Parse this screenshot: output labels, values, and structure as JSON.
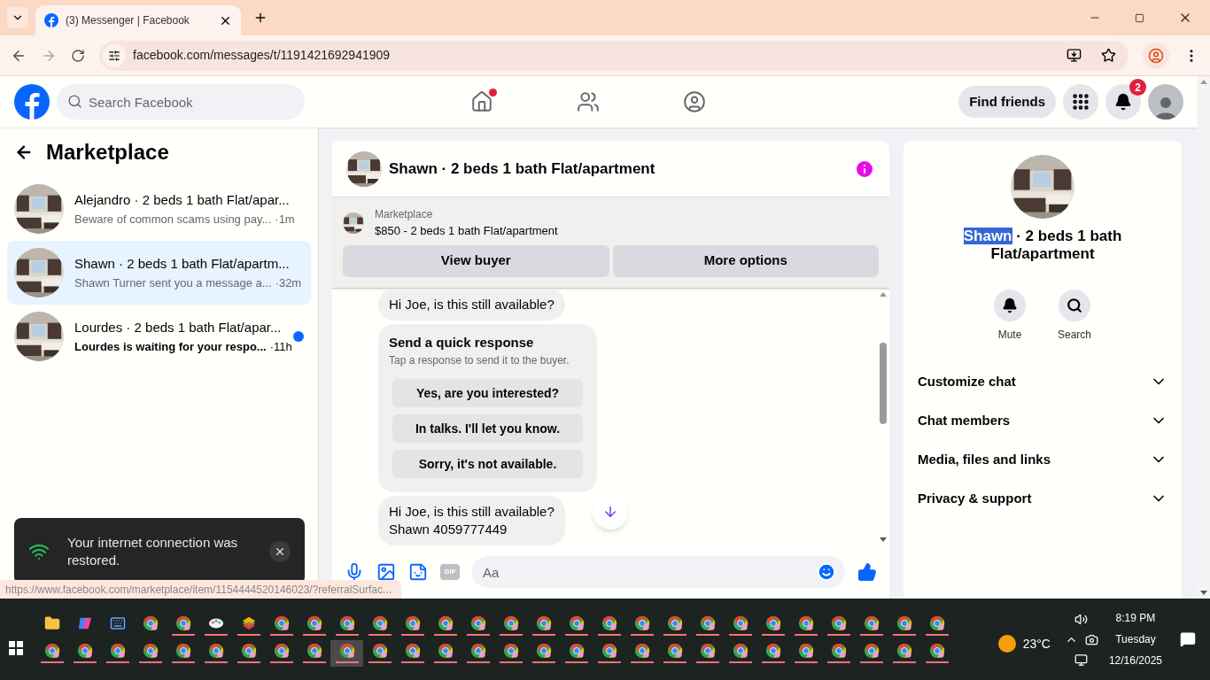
{
  "browser": {
    "tab_title": "(3) Messenger | Facebook",
    "url": "facebook.com/messages/t/1191421692941909",
    "status_url": "https://www.facebook.com/marketplace/item/1154444520146023/?referralSurfac..."
  },
  "header": {
    "search_placeholder": "Search Facebook",
    "nav": [
      {
        "kind": "home",
        "selected": false,
        "dot": true
      },
      {
        "kind": "friends",
        "selected": false,
        "dot": false
      },
      {
        "kind": "groups",
        "selected": false,
        "dot": false
      }
    ],
    "find_friends": "Find friends",
    "notifications_badge": "2"
  },
  "sidebar": {
    "title": "Marketplace",
    "chats": [
      {
        "name": "Alejandro · 2 beds 1 bath Flat/apar...",
        "preview": "Beware of common scams using pay...",
        "time": "·1m",
        "selected": false,
        "unread": false
      },
      {
        "name": "Shawn · 2 beds 1 bath Flat/apartm...",
        "preview": "Shawn Turner sent you a message a...",
        "time": "·32m",
        "selected": true,
        "unread": false
      },
      {
        "name": "Lourdes · 2 beds 1 bath Flat/apar...",
        "preview": "Lourdes is waiting for your respo...",
        "time": "·11h",
        "selected": false,
        "unread": true
      }
    ]
  },
  "chat": {
    "title": "Shawn · 2 beds 1 bath Flat/apartment",
    "listing": {
      "label": "Marketplace",
      "title": "$850 - 2 beds 1 bath Flat/apartment"
    },
    "actions": [
      "View buyer",
      "More options"
    ],
    "messages": [
      {
        "kind": "text",
        "lines": [
          "Hi Joe, is this still available?"
        ]
      },
      {
        "kind": "quick_response",
        "title": "Send a quick response",
        "subtitle": "Tap a response to send it to the buyer.",
        "options": [
          "Yes, are you interested?",
          "In talks. I'll let you know.",
          "Sorry, it's not available."
        ]
      },
      {
        "kind": "text",
        "lines": [
          "Hi Joe, is this still available?",
          "Shawn 4059777449"
        ]
      }
    ],
    "composer_placeholder": "Aa",
    "gif_label": "GIF"
  },
  "info": {
    "highlighted": "Shawn",
    "title_rest": " · 2 beds 1 bath Flat/apartment",
    "actions": [
      {
        "kind": "mute",
        "label": "Mute"
      },
      {
        "kind": "search",
        "label": "Search"
      }
    ],
    "sections": [
      {
        "label": "Customize chat",
        "expanded": false
      },
      {
        "label": "Chat members",
        "expanded": false
      },
      {
        "label": "Media, files and links",
        "expanded": false
      },
      {
        "label": "Privacy & support",
        "expanded": false
      }
    ]
  },
  "toast": {
    "text": "Your internet connection was restored."
  },
  "taskbar": {
    "top_row": [
      {
        "kind": "folder",
        "open": false,
        "selected": false
      },
      {
        "kind": "copilot",
        "open": false,
        "selected": false
      },
      {
        "kind": "keyboard",
        "open": false,
        "selected": false
      },
      {
        "kind": "chrome",
        "open": false,
        "selected": false
      },
      {
        "kind": "chrome",
        "open": true,
        "selected": false
      },
      {
        "kind": "paint",
        "open": true,
        "selected": false
      },
      {
        "kind": "stack",
        "open": true,
        "selected": false
      },
      {
        "kind": "chrome",
        "open": true,
        "selected": false
      },
      {
        "kind": "chrome",
        "open": true,
        "selected": false
      },
      {
        "kind": "chrome",
        "open": true,
        "selected": false
      },
      {
        "kind": "chrome",
        "open": true,
        "selected": false
      },
      {
        "kind": "chrome",
        "open": true,
        "selected": false
      },
      {
        "kind": "chrome",
        "open": true,
        "selected": false
      },
      {
        "kind": "chrome",
        "open": true,
        "selected": false
      },
      {
        "kind": "chrome",
        "open": true,
        "selected": false
      },
      {
        "kind": "chrome",
        "open": true,
        "selected": false
      },
      {
        "kind": "chrome",
        "open": true,
        "selected": false
      },
      {
        "kind": "chrome",
        "open": true,
        "selected": false
      },
      {
        "kind": "chrome",
        "open": true,
        "selected": false
      },
      {
        "kind": "chrome",
        "open": true,
        "selected": false
      },
      {
        "kind": "chrome",
        "open": true,
        "selected": false
      },
      {
        "kind": "chrome",
        "open": true,
        "selected": false
      },
      {
        "kind": "chrome",
        "open": true,
        "selected": false
      },
      {
        "kind": "chrome",
        "open": true,
        "selected": false
      },
      {
        "kind": "chrome",
        "open": true,
        "selected": false
      },
      {
        "kind": "chrome",
        "open": true,
        "selected": false
      },
      {
        "kind": "chrome",
        "open": true,
        "selected": false
      },
      {
        "kind": "chrome",
        "open": true,
        "selected": false
      }
    ],
    "bottom_row": [
      {
        "kind": "chrome",
        "open": true,
        "selected": false
      },
      {
        "kind": "chrome",
        "open": true,
        "selected": false
      },
      {
        "kind": "chrome",
        "open": true,
        "selected": false
      },
      {
        "kind": "chrome",
        "open": true,
        "selected": false
      },
      {
        "kind": "chrome",
        "open": true,
        "selected": false
      },
      {
        "kind": "chrome",
        "open": true,
        "selected": false
      },
      {
        "kind": "chrome",
        "open": true,
        "selected": false
      },
      {
        "kind": "chrome",
        "open": true,
        "selected": false
      },
      {
        "kind": "chrome",
        "open": true,
        "selected": false
      },
      {
        "kind": "chrome",
        "open": true,
        "selected": true
      },
      {
        "kind": "chrome",
        "open": true,
        "selected": false
      },
      {
        "kind": "chrome",
        "open": true,
        "selected": false
      },
      {
        "kind": "chrome",
        "open": true,
        "selected": false
      },
      {
        "kind": "chrome",
        "open": true,
        "selected": false
      },
      {
        "kind": "chrome",
        "open": true,
        "selected": false
      },
      {
        "kind": "chrome",
        "open": true,
        "selected": false
      },
      {
        "kind": "chrome",
        "open": true,
        "selected": false
      },
      {
        "kind": "chrome",
        "open": true,
        "selected": false
      },
      {
        "kind": "chrome",
        "open": true,
        "selected": false
      },
      {
        "kind": "chrome",
        "open": true,
        "selected": false
      },
      {
        "kind": "chrome",
        "open": true,
        "selected": false
      },
      {
        "kind": "chrome",
        "open": true,
        "selected": false
      },
      {
        "kind": "chrome",
        "open": true,
        "selected": false
      },
      {
        "kind": "chrome",
        "open": true,
        "selected": false
      },
      {
        "kind": "chrome",
        "open": true,
        "selected": false
      },
      {
        "kind": "chrome",
        "open": true,
        "selected": false
      },
      {
        "kind": "chrome",
        "open": true,
        "selected": false
      },
      {
        "kind": "chrome",
        "open": true,
        "selected": false
      }
    ],
    "weather": "23°C",
    "time": "8:19 PM",
    "day": "Tuesday",
    "date": "12/16/2025"
  }
}
